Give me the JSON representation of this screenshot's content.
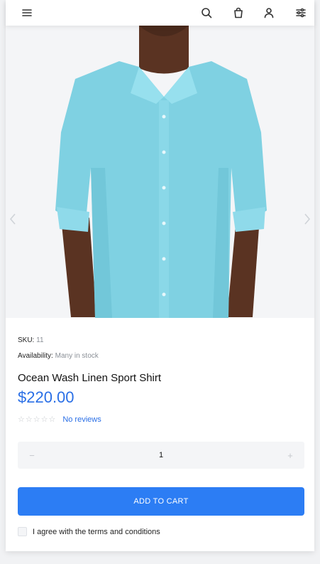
{
  "header": {
    "menu_icon": "hamburger-menu-icon",
    "search_icon": "search-icon",
    "bag_icon": "shopping-bag-icon",
    "account_icon": "user-icon",
    "filter_icon": "sliders-icon"
  },
  "product": {
    "image_icon": "shirt-product-image",
    "sku_label": "SKU:",
    "sku_value": "11",
    "availability_label": "Availability:",
    "availability_value": "Many in stock",
    "name": "Ocean Wash Linen Sport Shirt",
    "price": "$220.00",
    "stars": "☆☆☆☆☆",
    "reviews_link": "No reviews"
  },
  "quantity": {
    "minus": "−",
    "value": "1",
    "plus": "+"
  },
  "actions": {
    "add_to_cart": "ADD TO CART",
    "terms_label": "I agree with the terms and conditions"
  },
  "colors": {
    "accent": "#2c7df4",
    "price": "#2a6fe6"
  }
}
